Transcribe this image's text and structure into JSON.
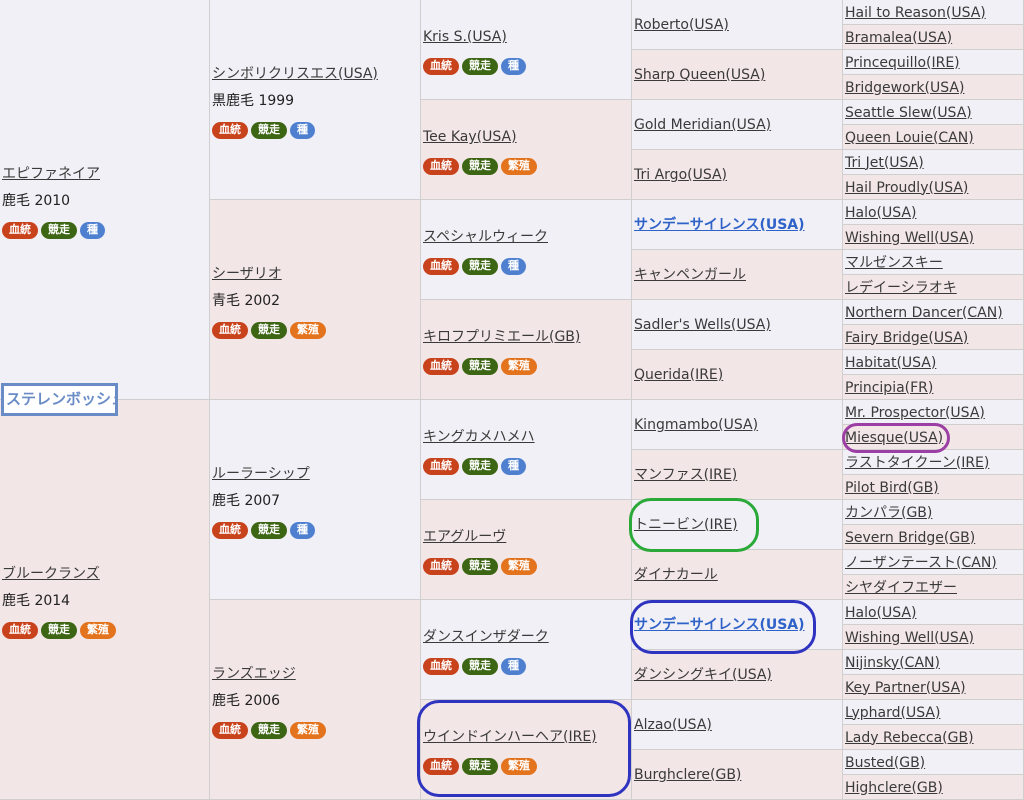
{
  "subject": "ステレンボッシュ",
  "badge_labels": {
    "ketto": "血統",
    "kyoso": "競走",
    "shu": "種",
    "hanshoku": "繁殖"
  },
  "sire": {
    "name": "エピファネイア",
    "coat": "鹿毛 2010",
    "role": "shu"
  },
  "dam": {
    "name": "ブルークランズ",
    "coat": "鹿毛 2014",
    "role": "hanshoku"
  },
  "gen2": [
    {
      "name": "シンボリクリスエス(USA)",
      "coat": "黒鹿毛 1999",
      "role": "shu"
    },
    {
      "name": "シーザリオ",
      "coat": "青毛 2002",
      "role": "hanshoku"
    },
    {
      "name": "ルーラーシップ",
      "coat": "鹿毛 2007",
      "role": "shu"
    },
    {
      "name": "ランズエッジ",
      "coat": "鹿毛 2006",
      "role": "hanshoku"
    }
  ],
  "gen3": [
    {
      "name": "Kris S.(USA)",
      "role": "shu"
    },
    {
      "name": "Tee Kay(USA)",
      "role": "hanshoku"
    },
    {
      "name": "スペシャルウィーク",
      "role": "shu"
    },
    {
      "name": "キロフプリミエール(GB)",
      "role": "hanshoku"
    },
    {
      "name": "キングカメハメハ",
      "role": "shu"
    },
    {
      "name": "エアグルーヴ",
      "role": "hanshoku"
    },
    {
      "name": "ダンスインザダーク",
      "role": "shu"
    },
    {
      "name": "ウインドインハーヘア(IRE)",
      "role": "hanshoku"
    }
  ],
  "gen4": [
    "Roberto(USA)",
    "Sharp Queen(USA)",
    "Gold Meridian(USA)",
    "Tri Argo(USA)",
    "サンデーサイレンス(USA)",
    "キャンペンガール",
    "Sadler's Wells(USA)",
    "Querida(IRE)",
    "Kingmambo(USA)",
    "マンファス(IRE)",
    "トニービン(IRE)",
    "ダイナカール",
    "サンデーサイレンス(USA)",
    "ダンシングキイ(USA)",
    "Alzao(USA)",
    "Burghclere(GB)"
  ],
  "gen5": [
    "Hail to Reason(USA)",
    "Bramalea(USA)",
    "Princequillo(IRE)",
    "Bridgework(USA)",
    "Seattle Slew(USA)",
    "Queen Louie(CAN)",
    "Tri Jet(USA)",
    "Hail Proudly(USA)",
    "Halo(USA)",
    "Wishing Well(USA)",
    "マルゼンスキー",
    "レデイーシラオキ",
    "Northern Dancer(CAN)",
    "Fairy Bridge(USA)",
    "Habitat(USA)",
    "Principia(FR)",
    "Mr. Prospector(USA)",
    "Miesque(USA)",
    "ラストタイクーン(IRE)",
    "Pilot Bird(GB)",
    "カンパラ(GB)",
    "Severn Bridge(GB)",
    "ノーザンテースト(CAN)",
    "シヤダイフエザー",
    "Halo(USA)",
    "Wishing Well(USA)",
    "Nijinsky(CAN)",
    "Key Partner(USA)",
    "Lyphard(USA)",
    "Lady Rebecca(GB)",
    "Busted(GB)",
    "Highclere(GB)"
  ],
  "colors": {
    "ketto": "#c8421c",
    "kyoso": "#3d6614",
    "shu": "#4f80d0",
    "hanshoku": "#e3731d",
    "link": "#3a3a3a",
    "highlight_link": "#2f62c8",
    "male_cell": "#f1f0f6",
    "female_cell": "#f3e6e6",
    "ring_blue": "#2e33c0",
    "ring_green": "#2aa938",
    "ring_purple": "#9b3fa5",
    "title_border": "#6a8cc6"
  }
}
